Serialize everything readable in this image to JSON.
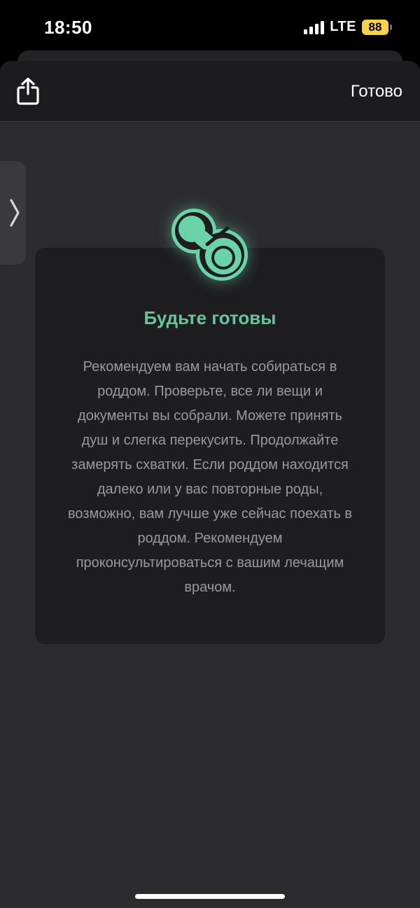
{
  "status_bar": {
    "time": "18:50",
    "network": "LTE",
    "battery": "88",
    "icons": [
      "signal-icon",
      "battery-icon"
    ]
  },
  "nav": {
    "share_icon": "share-icon",
    "done_label": "Готово"
  },
  "side_tab": {
    "icon": "chevron-right-icon"
  },
  "card": {
    "icon": "pacifier-icon",
    "accent_color": "#6ac3a0",
    "title": "Будьте готовы",
    "body": "Рекомендуем вам начать собираться в роддом. Проверьте, все ли вещи и документы вы собрали. Можете принять душ и слегка перекусить. Продолжайте замерять схватки. Если роддом находится далеко или у вас повторные роды, возможно, вам лучше уже сейчас поехать в роддом. Рекомендуем проконсультироваться с вашим лечащим врачом."
  }
}
